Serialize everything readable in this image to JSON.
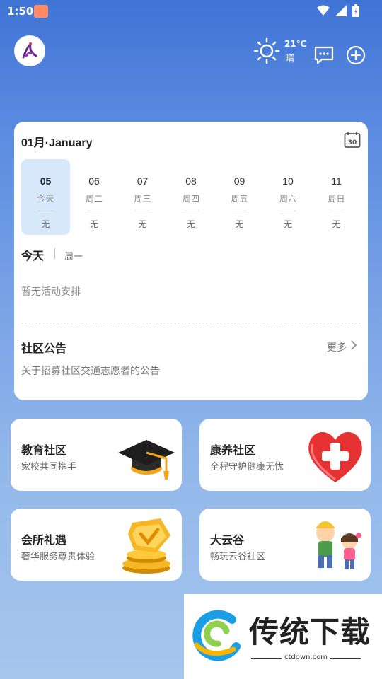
{
  "status_bar": {
    "time": "1:50"
  },
  "weather": {
    "temp": "21℃",
    "desc": "晴"
  },
  "calendar": {
    "title": "01月·January",
    "days": [
      {
        "num": "05",
        "week": "今天",
        "event": "无",
        "active": true
      },
      {
        "num": "06",
        "week": "周二",
        "event": "无"
      },
      {
        "num": "07",
        "week": "周三",
        "event": "无"
      },
      {
        "num": "08",
        "week": "周四",
        "event": "无"
      },
      {
        "num": "09",
        "week": "周五",
        "event": "无"
      },
      {
        "num": "10",
        "week": "周六",
        "event": "无"
      },
      {
        "num": "11",
        "week": "周日",
        "event": "无"
      }
    ],
    "calendar_icon_text": "30",
    "today_label": "今天",
    "today_week": "周一",
    "no_activity": "暂无活动安排"
  },
  "notice": {
    "title": "社区公告",
    "more": "更多",
    "items": [
      "关于招募社区交通志愿者的公告"
    ]
  },
  "tiles": [
    {
      "title": "教育社区",
      "subtitle": "家校共同携手",
      "icon": "graduation-cap-icon"
    },
    {
      "title": "康养社区",
      "subtitle": "全程守护健康无忧",
      "icon": "heart-cross-icon"
    },
    {
      "title": "会所礼遇",
      "subtitle": "奢华服务尊贵体验",
      "icon": "gold-badge-icon"
    },
    {
      "title": "大云谷",
      "subtitle": "畅玩云谷社区",
      "icon": "kids-icon"
    }
  ],
  "watermark": {
    "text": "传统下载",
    "url": "ctdown.com"
  },
  "colors": {
    "active_day_bg": "#d7e8fb",
    "background_top": "#3f74d6",
    "background_bottom": "#a6c6ee"
  }
}
